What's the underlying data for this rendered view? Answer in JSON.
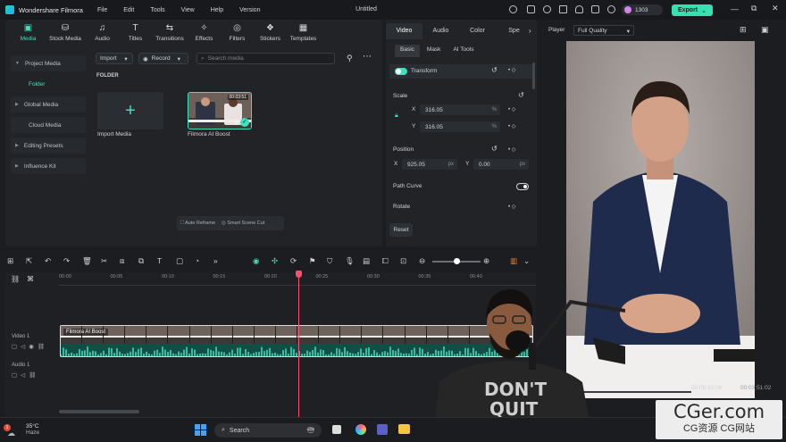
{
  "app": {
    "name": "Wondershare Filmora",
    "document_title": "Untitled",
    "credits": "1303",
    "export_label": "Export"
  },
  "menu": [
    "File",
    "Edit",
    "Tools",
    "View",
    "Help",
    "Version"
  ],
  "media_tabs": [
    {
      "label": "Media",
      "icon": "media-icon"
    },
    {
      "label": "Stock Media",
      "icon": "stock-media-icon"
    },
    {
      "label": "Audio",
      "icon": "music-icon"
    },
    {
      "label": "Titles",
      "icon": "titles-icon"
    },
    {
      "label": "Transitions",
      "icon": "transitions-icon"
    },
    {
      "label": "Effects",
      "icon": "effects-icon"
    },
    {
      "label": "Filters",
      "icon": "filters-icon"
    },
    {
      "label": "Stickers",
      "icon": "stickers-icon"
    },
    {
      "label": "Templates",
      "icon": "templates-icon"
    }
  ],
  "sidebar": [
    "Project Media",
    "Folder",
    "Global Media",
    "Cloud Media",
    "Editing Presets",
    "Influence Kit"
  ],
  "toolbar": {
    "import": "Import",
    "record": "Record",
    "search_placeholder": "Search media"
  },
  "folder_label": "FOLDER",
  "media_items": [
    {
      "label": "Import Media"
    },
    {
      "label": "Filmora AI Boost",
      "duration": "00:03:51"
    }
  ],
  "media_actions": [
    "Auto Reframe",
    "Smart Scene Cut"
  ],
  "properties": {
    "tabs": [
      "Video",
      "Audio",
      "Color",
      "Spe"
    ],
    "subtabs": [
      "Basic",
      "Mask",
      "AI Tools"
    ],
    "transform": "Transform",
    "scale": "Scale",
    "scale_x": "316.05",
    "scale_y": "316.05",
    "pct": "%",
    "position": "Position",
    "pos_x": "925.05",
    "pos_y": "0.00",
    "px": "px",
    "path_curve": "Path Curve",
    "rotate": "Rotate",
    "reset": "Reset",
    "x": "X",
    "y": "Y"
  },
  "player": {
    "label": "Player",
    "quality": "Full Quality",
    "current": "00:00:23:08",
    "total": "00:03:51:02"
  },
  "timeline": {
    "ruler": [
      "00:00",
      "00:05",
      "00:10",
      "00:15",
      "00:20",
      "00:25",
      "00:30",
      "00:35",
      "00:40"
    ],
    "video_track": "Video 1",
    "audio_track": "Audio 1",
    "clip_name": "Filmora AI Boost"
  },
  "taskbar": {
    "temp": "35°C",
    "weather": "Haze",
    "badge": "1",
    "search": "Search"
  },
  "watermark": {
    "line1": "CGer.com",
    "line2": "CG资源 CG网站"
  },
  "colors": {
    "accent": "#3fe0bf",
    "export": "#36e0b0",
    "playhead": "#ff4f6e"
  }
}
